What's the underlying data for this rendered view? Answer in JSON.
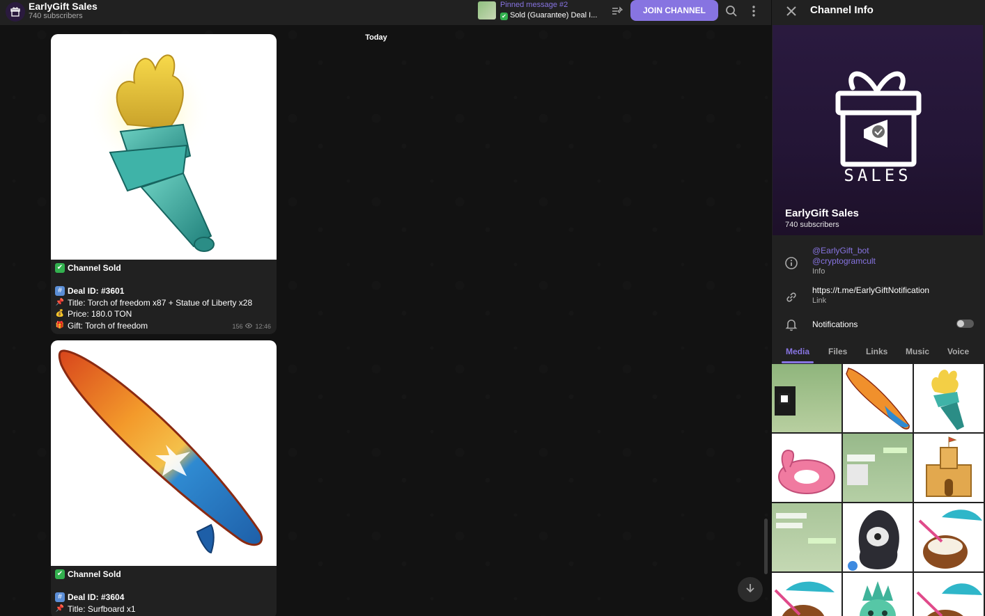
{
  "header": {
    "channel_title": "EarlyGift Sales",
    "channel_subtitle": "740 subscribers",
    "pinned_label": "Pinned message #2",
    "pinned_text": "Sold (Guarantee) Deal I...",
    "join_label": "JOIN CHANNEL"
  },
  "chat": {
    "date_label": "Today",
    "messages": [
      {
        "status": "Channel Sold",
        "deal": "Deal ID: #3601",
        "title": "Title: Torch of freedom x87 + Statue of Liberty x28",
        "price": "Price: 180.0 TON",
        "gift": "Gift: Torch of freedom",
        "views": "156",
        "time": "12:46"
      },
      {
        "status": "Channel Sold",
        "deal": "Deal ID: #3604",
        "title": "Title: Surfboard x1"
      }
    ]
  },
  "panel": {
    "title": "Channel Info",
    "cover_brand": "SALES",
    "cover_name": "EarlyGift Sales",
    "cover_sub": "740 subscribers",
    "info_link1": "@EarlyGift_bot",
    "info_link2": "@cryptogramcult",
    "info_caption": "Info",
    "link_value": "https://t.me/EarlyGiftNotification",
    "link_caption": "Link",
    "notifications_label": "Notifications",
    "notifications_on": false,
    "tabs": [
      "Media",
      "Files",
      "Links",
      "Music",
      "Voice"
    ],
    "active_tab": "Media"
  },
  "colors": {
    "accent": "#8774e1",
    "header_bg": "#212121",
    "chat_bg": "#121212",
    "bubble_bg": "#212121"
  },
  "icons": [
    "channel-avatar-icon",
    "pin-list-icon",
    "search-icon",
    "more-vertical-icon",
    "close-icon",
    "info-circle-icon",
    "link-icon",
    "bell-icon",
    "arrow-down-icon"
  ]
}
